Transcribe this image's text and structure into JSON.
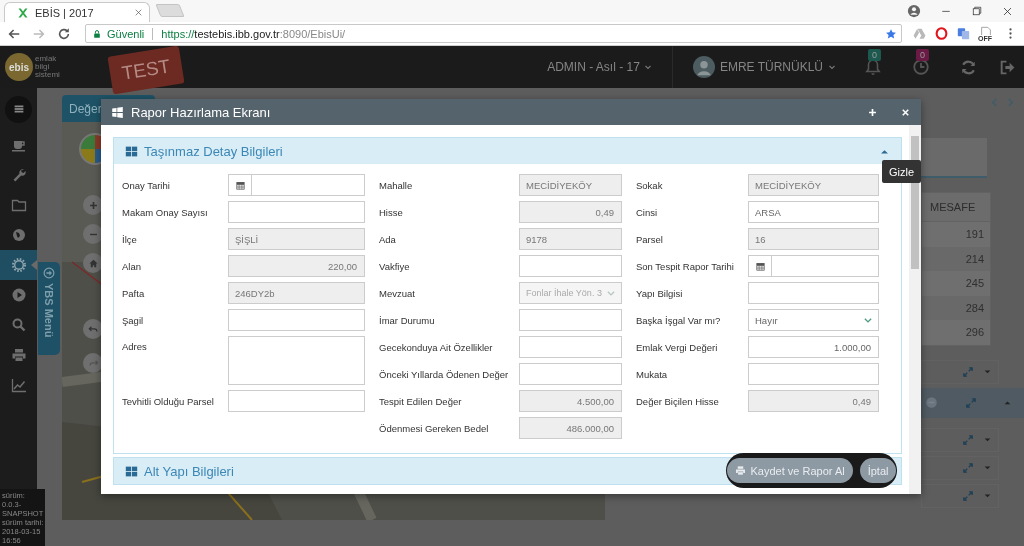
{
  "browser": {
    "tab_title": "EBİS | 2017",
    "secure_label": "Güvenli",
    "url_scheme": "https://",
    "url_host": "testebis.ibb.gov.tr",
    "url_path": ":8090/EbisUi/",
    "extension_badge": "OFF"
  },
  "header": {
    "logo_text": "ebis",
    "logo_caption": "emlak bilgi sistemi",
    "env_badge": "TEST",
    "role": "ADMIN - Asıl - 17",
    "user": "EMRE TÜRNÜKLÜ",
    "notifications": "0",
    "pending": "0"
  },
  "sidebar": {
    "items": [
      {
        "kind": "menu",
        "selected": false
      },
      {
        "kind": "cup",
        "selected": false
      },
      {
        "kind": "wrench",
        "selected": false
      },
      {
        "kind": "folder",
        "selected": false
      },
      {
        "kind": "globe",
        "selected": false
      },
      {
        "kind": "gear",
        "selected": true
      },
      {
        "kind": "play",
        "selected": false
      },
      {
        "kind": "search",
        "selected": false
      },
      {
        "kind": "print",
        "selected": false
      },
      {
        "kind": "chart",
        "selected": false
      }
    ],
    "version_lines": [
      "sürüm:",
      "0.0.3-",
      "SNAPSHOT",
      "sürüm tarihi:",
      "2018-03-15",
      "16:56"
    ],
    "side_tab": "YBS Menü"
  },
  "map_panel": {
    "title": "Değer"
  },
  "side_panel": {
    "column": "MESAFE",
    "rows": [
      "191",
      "214",
      "245",
      "284",
      "296"
    ]
  },
  "modal": {
    "title": "Rapor Hazırlama Ekranı",
    "sections": [
      {
        "title": "Taşınmaz Detay Bilgileri",
        "expanded": true,
        "tooltip": "Gizle",
        "columns": [
          [
            {
              "label": "Onay Tarihi",
              "kind": "date",
              "readonly": false
            },
            {
              "label": "Makam Onay Sayısı",
              "kind": "text",
              "readonly": false
            },
            {
              "label": "İlçe",
              "kind": "text",
              "value": "ŞİŞLİ",
              "readonly": true
            },
            {
              "label": "Alan",
              "kind": "number",
              "value": "220,00",
              "readonly": true
            },
            {
              "label": "Pafta",
              "kind": "text",
              "value": "246DY2b",
              "readonly": true
            },
            {
              "label": "Şagil",
              "kind": "text",
              "readonly": false
            },
            {
              "label": "Adres",
              "kind": "textarea",
              "readonly": false
            },
            {
              "label": "Tevhitli Olduğu Parsel",
              "kind": "text",
              "readonly": false
            }
          ],
          [
            {
              "label": "Mahalle",
              "kind": "text",
              "value": "MECİDİYEKÖY",
              "readonly": true
            },
            {
              "label": "Hisse",
              "kind": "number",
              "value": "0,49",
              "readonly": true
            },
            {
              "label": "Ada",
              "kind": "text",
              "value": "9178",
              "readonly": true
            },
            {
              "label": "Vakfiye",
              "kind": "text",
              "readonly": false
            },
            {
              "label": "Mevzuat",
              "kind": "select",
              "value": "Fonlar İhale Yön. 3",
              "readonly": true
            },
            {
              "label": "İmar Durumu",
              "kind": "text",
              "readonly": false
            },
            {
              "label": "Gecekonduya Ait Özellikler",
              "kind": "text",
              "readonly": false
            },
            {
              "label": "Önceki Yıllarda Ödenen Değer",
              "kind": "text",
              "readonly": false
            },
            {
              "label": "Tespit Edilen Değer",
              "kind": "number",
              "value": "4.500,00",
              "readonly": true
            },
            {
              "label": "Ödenmesi Gereken Bedel",
              "kind": "number",
              "value": "486.000,00",
              "readonly": true
            }
          ],
          [
            {
              "label": "Sokak",
              "kind": "text",
              "value": "MECİDİYEKÖY",
              "readonly": true
            },
            {
              "label": "Cinsi",
              "kind": "text",
              "value": "ARSA",
              "readonly": false
            },
            {
              "label": "Parsel",
              "kind": "text",
              "value": "16",
              "readonly": true
            },
            {
              "label": "Son Tespit Rapor Tarihi",
              "kind": "date",
              "readonly": false
            },
            {
              "label": "Yapı Bilgisi",
              "kind": "text",
              "readonly": false
            },
            {
              "label": "Başka İşgal Var mı?",
              "kind": "select",
              "value": "Hayır",
              "readonly": false
            },
            {
              "label": "Emlak Vergi Değeri",
              "kind": "number",
              "value": "1.000,00",
              "readonly": false
            },
            {
              "label": "Mukata",
              "kind": "text",
              "readonly": false
            },
            {
              "label": "Değer Biçilen Hisse",
              "kind": "number",
              "value": "0,49",
              "readonly": true
            }
          ]
        ]
      },
      {
        "title": "Alt Yapı Bilgileri"
      }
    ],
    "actions": [
      {
        "label": "Kaydet ve Rapor Al",
        "kind": "print"
      },
      {
        "label": "İptal",
        "kind": "plain"
      }
    ]
  }
}
